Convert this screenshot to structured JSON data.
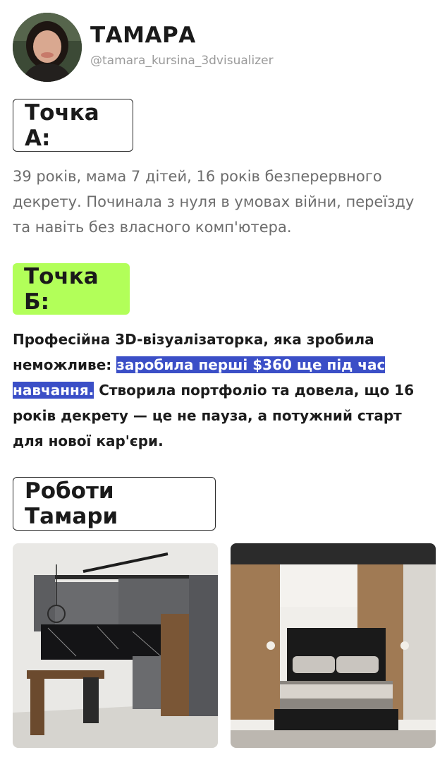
{
  "profile": {
    "name": "ТАМАРА",
    "handle": "@tamara_kursina_3dvisualizer"
  },
  "point_a": {
    "label": "Точка А:",
    "text": "39 років, мама 7 дітей, 16 років безперервного декрету. Починала з нуля в умовах війни, переїзду та навіть без власного комп'ютера."
  },
  "point_b": {
    "label": "Точка Б:",
    "text_before": "Професійна 3D-візуалізаторка, яка зробила неможливе: ",
    "text_highlight": "заробила перші $360 ще під час навчання.",
    "text_after": " Створила портфоліо та довела, що 16 років декрету — це не пауза, а потужний старт для нової кар'єри."
  },
  "works": {
    "label": "Роботи Тамари"
  },
  "colors": {
    "point_b_bg": "#b2ff59",
    "highlight_bg": "#3b4fc7",
    "muted_text": "#6d6d6d"
  }
}
